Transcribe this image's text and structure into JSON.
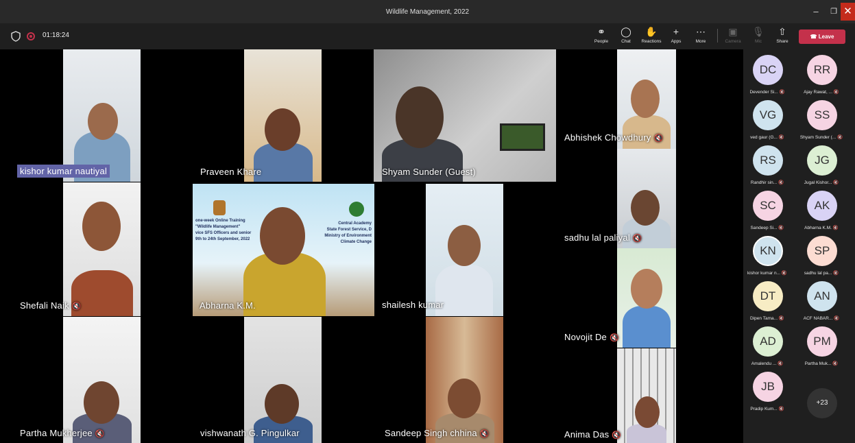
{
  "window": {
    "title": "Wildlife Management, 2022"
  },
  "meeting": {
    "timer": "01:18:24"
  },
  "toolbar": {
    "people": "People",
    "chat": "Chat",
    "reactions": "Reactions",
    "apps": "Apps",
    "more": "More",
    "camera": "Camera",
    "mic": "Mic",
    "share": "Share",
    "leave": "Leave"
  },
  "tiles": {
    "t1": "kishor kumar nautiyal",
    "t2": "Praveen Khare",
    "t3": "Shyam Sunder (Guest)",
    "t4": "Abhishek Chowdhury",
    "t5": "sadhu lal paliyal",
    "t6": "Shefali Naik",
    "t7": "Abharna K.M.",
    "t8": "shailesh kumar",
    "t9": "Novojit De",
    "t10": "Partha Mukherjee",
    "t11": "vishwanath G. Pingulkar",
    "t12": "Sandeep Singh chhina",
    "t13": "Anima Das"
  },
  "slide": {
    "left_lines": [
      "one-week Online Training",
      "\"Wildlife Management\"",
      "vice SFS Officers and senior",
      "9th to 24th September, 2022"
    ],
    "right_lines": [
      "Central Academy",
      "State Forest Service, D",
      "Ministry of Environment",
      "Climate Change"
    ]
  },
  "participants": [
    {
      "initials": "DC",
      "name": "Devender Si...",
      "color": "#d9d3f5"
    },
    {
      "initials": "RR",
      "name": "Ajay Rawat, ...",
      "color": "#f6d4e3"
    },
    {
      "initials": "VG",
      "name": "ved gaur (G...",
      "color": "#cfe3ee"
    },
    {
      "initials": "SS",
      "name": "Shyam Sunder (...",
      "color": "#f6d4e3"
    },
    {
      "initials": "RS",
      "name": "Randhir sin...",
      "color": "#cfe3ee"
    },
    {
      "initials": "JG",
      "name": "Jugal Kishor...",
      "color": "#dcefd3"
    },
    {
      "initials": "SC",
      "name": "Sandeep Si...",
      "color": "#f6d4e3"
    },
    {
      "initials": "AK",
      "name": "Abharna K.M.",
      "color": "#d9d3f5"
    },
    {
      "initials": "KN",
      "name": "kishor kumar n...",
      "color": "#cfe3ee"
    },
    {
      "initials": "SP",
      "name": "sadhu lal pa...",
      "color": "#fcdcd2"
    },
    {
      "initials": "DT",
      "name": "Dipen Tama...",
      "color": "#f7ecc4"
    },
    {
      "initials": "AN",
      "name": "ACF NABAR...",
      "color": "#cfe3ee"
    },
    {
      "initials": "AD",
      "name": "Amalendu ...",
      "color": "#dcefd3"
    },
    {
      "initials": "PM",
      "name": "Partha Muk...",
      "color": "#f6d4e3"
    },
    {
      "initials": "JB",
      "name": "Pradip Kum...",
      "color": "#f6d4e3"
    }
  ],
  "overflow": {
    "count": "+23"
  }
}
